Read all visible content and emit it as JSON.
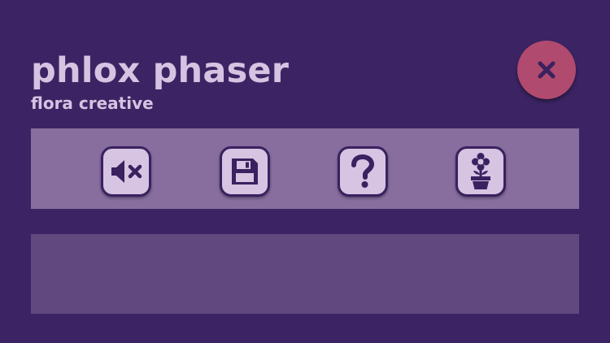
{
  "header": {
    "title": "phlox phaser",
    "subtitle": "flora creative"
  },
  "close_button": {
    "icon": "close-icon",
    "color": "#b04a6e"
  },
  "toolbar": {
    "buttons": [
      {
        "name": "mute",
        "icon": "sound-muted-icon"
      },
      {
        "name": "save",
        "icon": "floppy-disk-icon"
      },
      {
        "name": "help",
        "icon": "question-mark-icon"
      },
      {
        "name": "flower",
        "icon": "flower-pot-icon"
      }
    ]
  },
  "colors": {
    "background": "#3c2464",
    "toolbar_bg": "#876e9f",
    "button_bg": "#d6c4e2",
    "icon_color": "#3a2160",
    "panel_bg": "#614980",
    "text": "#d6c3e2"
  }
}
